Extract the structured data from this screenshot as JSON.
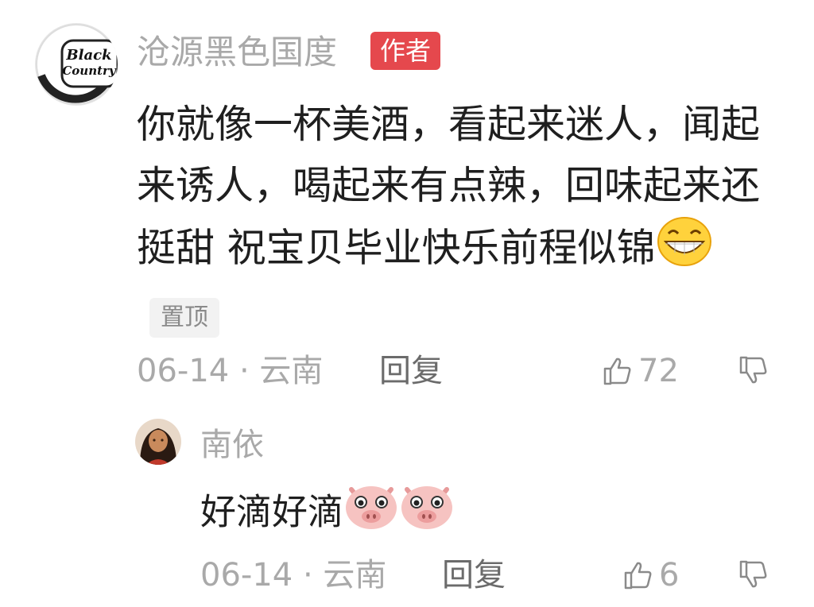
{
  "comment": {
    "author_name": "沧源黑色国度",
    "author_badge": "作者",
    "avatar_text_line1": "Black",
    "avatar_text_line2": "Country",
    "text": "你就像一杯美酒，看起来迷人，闻起来诱人，喝起来有点辣，回味起来还挺甜 祝宝贝毕业快乐前程似锦",
    "emoji_icon": "grin-emoji-icon",
    "pinned_label": "置顶",
    "date": "06-14",
    "location": "云南",
    "reply_label": "回复",
    "like_count": "72",
    "colors": {
      "badge": "#e5484d",
      "muted": "#a9a9a9",
      "text": "#1f1f1f"
    }
  },
  "reply": {
    "author_name": "南依",
    "text": "好滴好滴",
    "emoji_icons": [
      "pig-face-emoji-icon",
      "pig-face-emoji-icon"
    ],
    "date": "06-14",
    "location": "云南",
    "reply_label": "回复",
    "like_count": "6"
  }
}
